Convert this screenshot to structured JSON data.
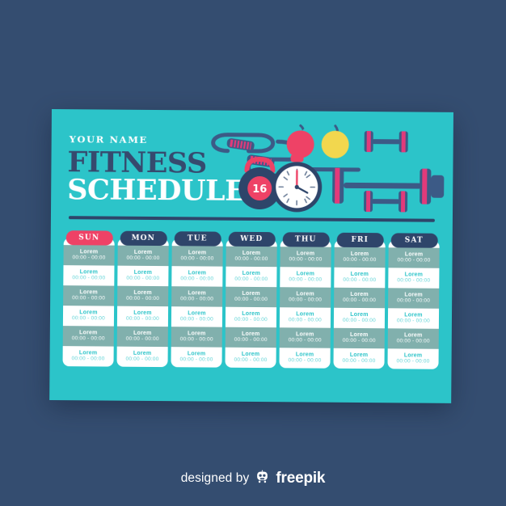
{
  "theme": {
    "background": "#344d70",
    "card": "#2cc4c9",
    "navy": "#2e456a",
    "accent_pink": "#ee4266",
    "band": "#81b0ad",
    "white": "#ffffff",
    "yellow": "#f2d74e"
  },
  "header": {
    "your_name": "YOUR NAME",
    "title_line1": "FITNESS",
    "title_line2": "SCHEDULE"
  },
  "illustration": {
    "items": [
      "jump-rope",
      "red-apple",
      "yellow-apple",
      "kettlebell",
      "stopwatch",
      "barbell",
      "dumbbell",
      "dumbbell"
    ],
    "kettlebell_weight": "16"
  },
  "schedule": {
    "slot_title": "Lorem",
    "slot_time": "00:00 - 00:00",
    "rows": 6,
    "columns": [
      {
        "day": "SUN",
        "highlighted": true,
        "slots": [
          {
            "title": "Lorem",
            "time": "00:00 - 00:00"
          },
          {
            "title": "Lorem",
            "time": "00:00 - 00:00"
          },
          {
            "title": "Lorem",
            "time": "00:00 - 00:00"
          },
          {
            "title": "Lorem",
            "time": "00:00 - 00:00"
          },
          {
            "title": "Lorem",
            "time": "00:00 - 00:00"
          },
          {
            "title": "Lorem",
            "time": "00:00 - 00:00"
          }
        ]
      },
      {
        "day": "MON",
        "highlighted": false,
        "slots": [
          {
            "title": "Lorem",
            "time": "00:00 - 00:00"
          },
          {
            "title": "Lorem",
            "time": "00:00 - 00:00"
          },
          {
            "title": "Lorem",
            "time": "00:00 - 00:00"
          },
          {
            "title": "Lorem",
            "time": "00:00 - 00:00"
          },
          {
            "title": "Lorem",
            "time": "00:00 - 00:00"
          },
          {
            "title": "Lorem",
            "time": "00:00 - 00:00"
          }
        ]
      },
      {
        "day": "TUE",
        "highlighted": false,
        "slots": [
          {
            "title": "Lorem",
            "time": "00:00 - 00:00"
          },
          {
            "title": "Lorem",
            "time": "00:00 - 00:00"
          },
          {
            "title": "Lorem",
            "time": "00:00 - 00:00"
          },
          {
            "title": "Lorem",
            "time": "00:00 - 00:00"
          },
          {
            "title": "Lorem",
            "time": "00:00 - 00:00"
          },
          {
            "title": "Lorem",
            "time": "00:00 - 00:00"
          }
        ]
      },
      {
        "day": "WED",
        "highlighted": false,
        "slots": [
          {
            "title": "Lorem",
            "time": "00:00 - 00:00"
          },
          {
            "title": "Lorem",
            "time": "00:00 - 00:00"
          },
          {
            "title": "Lorem",
            "time": "00:00 - 00:00"
          },
          {
            "title": "Lorem",
            "time": "00:00 - 00:00"
          },
          {
            "title": "Lorem",
            "time": "00:00 - 00:00"
          },
          {
            "title": "Lorem",
            "time": "00:00 - 00:00"
          }
        ]
      },
      {
        "day": "THU",
        "highlighted": false,
        "slots": [
          {
            "title": "Lorem",
            "time": "00:00 - 00:00"
          },
          {
            "title": "Lorem",
            "time": "00:00 - 00:00"
          },
          {
            "title": "Lorem",
            "time": "00:00 - 00:00"
          },
          {
            "title": "Lorem",
            "time": "00:00 - 00:00"
          },
          {
            "title": "Lorem",
            "time": "00:00 - 00:00"
          },
          {
            "title": "Lorem",
            "time": "00:00 - 00:00"
          }
        ]
      },
      {
        "day": "FRI",
        "highlighted": false,
        "slots": [
          {
            "title": "Lorem",
            "time": "00:00 - 00:00"
          },
          {
            "title": "Lorem",
            "time": "00:00 - 00:00"
          },
          {
            "title": "Lorem",
            "time": "00:00 - 00:00"
          },
          {
            "title": "Lorem",
            "time": "00:00 - 00:00"
          },
          {
            "title": "Lorem",
            "time": "00:00 - 00:00"
          },
          {
            "title": "Lorem",
            "time": "00:00 - 00:00"
          }
        ]
      },
      {
        "day": "SAT",
        "highlighted": false,
        "slots": [
          {
            "title": "Lorem",
            "time": "00:00 - 00:00"
          },
          {
            "title": "Lorem",
            "time": "00:00 - 00:00"
          },
          {
            "title": "Lorem",
            "time": "00:00 - 00:00"
          },
          {
            "title": "Lorem",
            "time": "00:00 - 00:00"
          },
          {
            "title": "Lorem",
            "time": "00:00 - 00:00"
          },
          {
            "title": "Lorem",
            "time": "00:00 - 00:00"
          }
        ]
      }
    ]
  },
  "footer": {
    "designed_by": "designed by",
    "brand": "freepik",
    "logo": "freepik-robot-icon"
  }
}
